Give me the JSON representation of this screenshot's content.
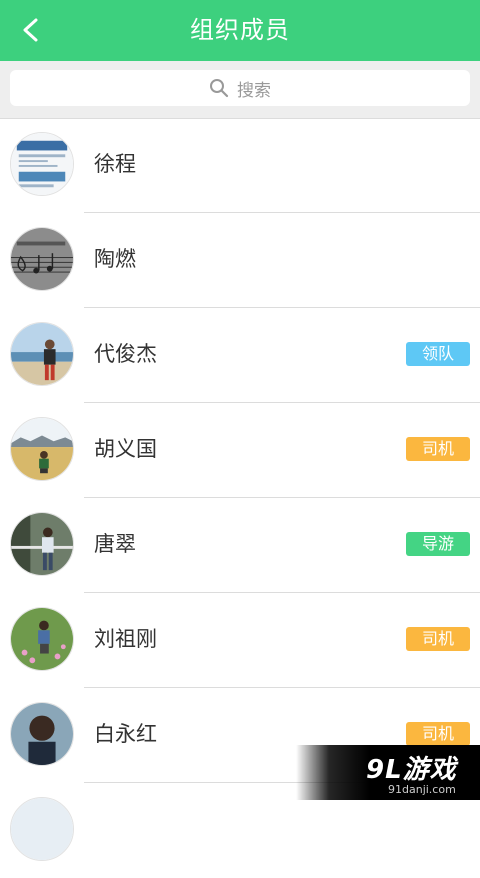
{
  "header": {
    "title": "组织成员",
    "back_icon": "chevron-left-icon",
    "color": "#3dd07e"
  },
  "search": {
    "placeholder": "搜索",
    "icon": "search-icon"
  },
  "members": [
    {
      "name": "徐程",
      "role": ""
    },
    {
      "name": "陶燃",
      "role": ""
    },
    {
      "name": "代俊杰",
      "role": "领队",
      "role_color": "#5ec8f5"
    },
    {
      "name": "胡义国",
      "role": "司机",
      "role_color": "#fbb73f"
    },
    {
      "name": "唐翠",
      "role": "导游",
      "role_color": "#44d484"
    },
    {
      "name": "刘祖刚",
      "role": "司机",
      "role_color": "#fbb73f"
    },
    {
      "name": "白永红",
      "role": "司机",
      "role_color": "#fbb73f"
    }
  ],
  "watermark": {
    "logo": "9L游戏",
    "url": "91danji.com"
  }
}
